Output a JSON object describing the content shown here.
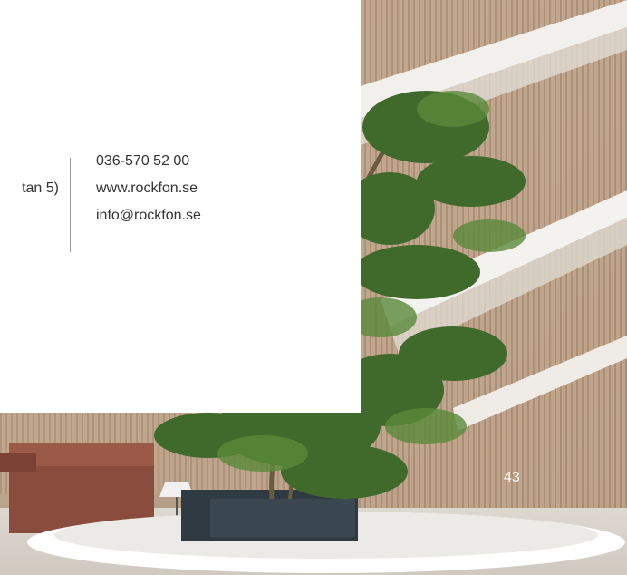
{
  "contact": {
    "left_lines": [
      "",
      "tan 5)",
      ""
    ],
    "phone": "036-570 52 00",
    "website": "www.rockfon.se",
    "email": "info@rockfon.se"
  },
  "page": {
    "number": "43"
  },
  "colors": {
    "card_background": "#ffffff",
    "text": "#333333",
    "divider": "#9a9a9a",
    "page_number": "#ffffff"
  }
}
